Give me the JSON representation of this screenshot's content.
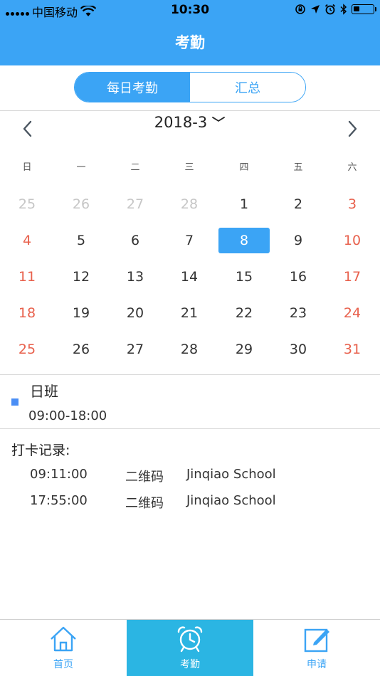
{
  "status_bar": {
    "carrier": "中国移动",
    "time": "10:30",
    "icons": [
      "signal-icon",
      "wifi-icon",
      "lock-rotation-icon",
      "location-icon",
      "alarm-icon",
      "bluetooth-icon",
      "battery-icon"
    ]
  },
  "nav": {
    "title": "考勤"
  },
  "segment": {
    "tabs": [
      {
        "label": "每日考勤",
        "active": true
      },
      {
        "label": "汇总",
        "active": false
      }
    ]
  },
  "calendar": {
    "month_label": "2018-3",
    "weekdays": [
      "日",
      "一",
      "二",
      "三",
      "四",
      "五",
      "六"
    ],
    "weeks": [
      [
        "25",
        "26",
        "27",
        "28",
        "1",
        "2",
        "3"
      ],
      [
        "4",
        "5",
        "6",
        "7",
        "8",
        "9",
        "10"
      ],
      [
        "11",
        "12",
        "13",
        "14",
        "15",
        "16",
        "17"
      ],
      [
        "18",
        "19",
        "20",
        "21",
        "22",
        "23",
        "24"
      ],
      [
        "25",
        "26",
        "27",
        "28",
        "29",
        "30",
        "31"
      ]
    ],
    "selected_day": "8"
  },
  "shift": {
    "name": "日班",
    "time": "09:00-18:00"
  },
  "records": {
    "title": "打卡记录:",
    "items": [
      {
        "time": "09:11:00",
        "method": "二维码",
        "place": "Jinqiao School"
      },
      {
        "time": "17:55:00",
        "method": "二维码",
        "place": "Jinqiao School"
      }
    ]
  },
  "tab_bar": {
    "tabs": [
      {
        "label": "首页",
        "icon": "home-icon",
        "active": false
      },
      {
        "label": "考勤",
        "icon": "alarm-clock-icon",
        "active": true
      },
      {
        "label": "申请",
        "icon": "edit-icon",
        "active": false
      }
    ]
  },
  "colors": {
    "primary": "#3ba4f5",
    "active_tab": "#2bb5e3",
    "weekend": "#e8604c",
    "muted": "#c6c6c6"
  }
}
